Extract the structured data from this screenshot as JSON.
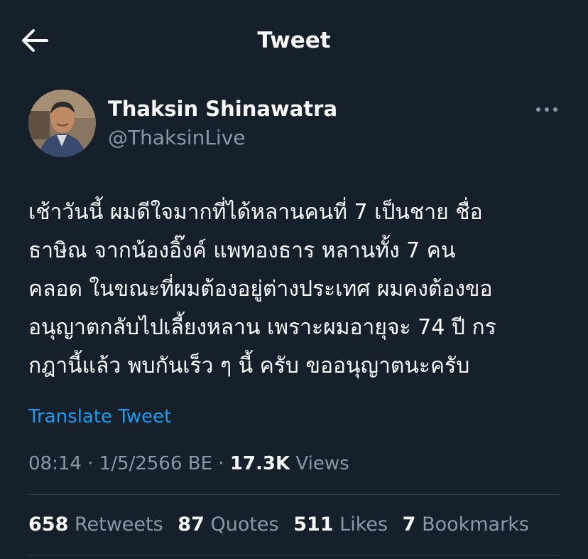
{
  "header": {
    "title": "Tweet",
    "back_icon": "arrow-left-icon"
  },
  "tweet": {
    "author": {
      "name": "Thaksin Shinawatra",
      "handle": "@ThaksinLive"
    },
    "more_icon": "more-horizontal-icon",
    "text_lines": [
      "เช้าวันนี้ ผมดีใจมากที่ได้หลานคนที่  7  เป็นชาย  ชื่อ",
      "ธาษิณ จากน้องอิ๊งค์ แพทองธาร หลานทั้ง 7 คน",
      "คลอด ในขณะที่ผมต้องอยู่ต่างประเทศ ผมคงต้องขอ",
      "อนุญาตกลับไปเลี้ยงหลาน เพราะผมอายุจะ 74 ปี กร",
      "กฎานี้แล้ว พบกันเร็ว ๆ นี้ ครับ ขออนุญาตนะครับ"
    ],
    "translate_label": "Translate Tweet",
    "time": "08:14",
    "separator": "·",
    "date": "1/5/2566 BE",
    "views_count": "17.3K",
    "views_label": "Views"
  },
  "stats": {
    "retweets_count": "658",
    "retweets_label": "Retweets",
    "quotes_count": "87",
    "quotes_label": "Quotes",
    "likes_count": "511",
    "likes_label": "Likes",
    "bookmarks_count": "7",
    "bookmarks_label": "Bookmarks"
  },
  "colors": {
    "background": "#15202b",
    "text_primary": "#f7f9f9",
    "text_secondary": "#8b98a5",
    "link": "#1d9bf0",
    "divider": "#38444d"
  }
}
